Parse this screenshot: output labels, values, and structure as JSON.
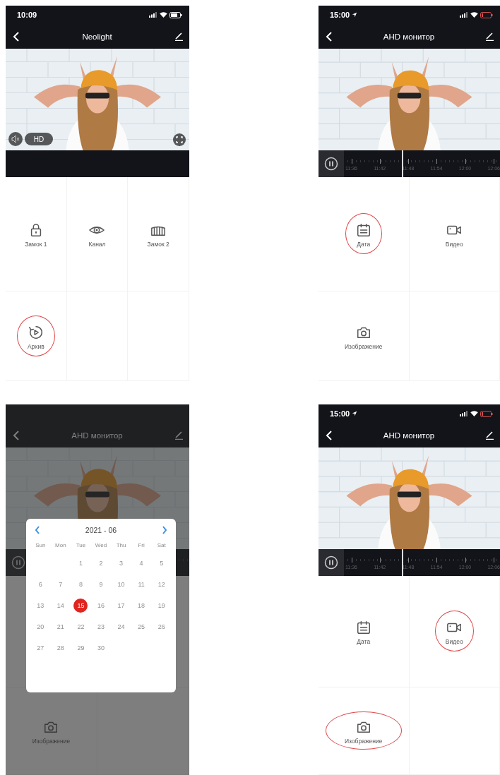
{
  "screens": [
    {
      "kind": "live",
      "status_bar": {
        "time": "10:09",
        "battery_low": false
      },
      "title": "Neolight",
      "hd_label": "HD",
      "action_rows": [
        [
          {
            "kind": "lock",
            "label": "Замок 1",
            "highlighted": false
          },
          {
            "kind": "eye",
            "label": "Канал",
            "highlighted": false
          },
          {
            "kind": "gate",
            "label": "Замок 2",
            "highlighted": false
          }
        ],
        [
          {
            "kind": "archive",
            "label": "Архив",
            "highlighted": true
          }
        ]
      ]
    },
    {
      "kind": "playback",
      "status_bar": {
        "time": "15:00",
        "location": true,
        "battery_low": true
      },
      "title": "AHD монитор",
      "timeline": {
        "playing": true,
        "labels": [
          "11:36",
          "11:42",
          "11:48",
          "11:54",
          "12:00",
          "12:06"
        ]
      },
      "action_rows": [
        [
          {
            "kind": "date",
            "label": "Дата",
            "highlighted": true
          },
          {
            "kind": "video",
            "label": "Видео",
            "highlighted": false
          }
        ],
        [
          {
            "label": "Изображение",
            "highlighted": false
          }
        ]
      ]
    },
    {
      "kind": "playback",
      "dimmed": true,
      "title": "AHD монитор",
      "timeline": {
        "playing": true
      },
      "dialog": {
        "title": "2021 - 06",
        "weekdays": [
          "Sun",
          "Mon",
          "Tue",
          "Wed",
          "Thu",
          "Fri",
          "Sat"
        ],
        "weeks": [
          [
            {
              "label": "1",
              "selected": false
            },
            {
              "label": "2",
              "selected": false
            },
            {
              "label": "3",
              "selected": false
            },
            {
              "label": "4",
              "selected": false
            },
            {
              "label": "5",
              "selected": false
            }
          ],
          [
            {
              "label": "6",
              "selected": false
            },
            {
              "label": "7",
              "selected": false
            },
            {
              "label": "8",
              "selected": false
            },
            {
              "label": "9",
              "selected": false
            },
            {
              "label": "10",
              "selected": false
            },
            {
              "label": "11",
              "selected": false
            },
            {
              "label": "12",
              "selected": false
            }
          ],
          [
            {
              "label": "13",
              "selected": false
            },
            {
              "label": "14",
              "selected": false
            },
            {
              "label": "15",
              "selected": true
            },
            {
              "label": "16",
              "selected": false
            },
            {
              "label": "17",
              "selected": false
            },
            {
              "label": "18",
              "selected": false
            },
            {
              "label": "19",
              "selected": false
            }
          ],
          [
            {
              "label": "20",
              "selected": false
            },
            {
              "label": "21",
              "selected": false
            },
            {
              "label": "22",
              "selected": false
            },
            {
              "label": "23",
              "selected": false
            },
            {
              "label": "24",
              "selected": false
            },
            {
              "label": "25",
              "selected": false
            },
            {
              "label": "26",
              "selected": false
            }
          ],
          [
            {
              "label": "27",
              "selected": false
            },
            {
              "label": "28",
              "selected": false
            },
            {
              "label": "29",
              "selected": false
            },
            {
              "label": "30",
              "selected": false
            }
          ]
        ]
      },
      "action_rows": [
        [
          {
            "label": "Изображение",
            "highlighted": false
          }
        ]
      ]
    },
    {
      "kind": "playback",
      "status_bar": {
        "time": "15:00",
        "location": true,
        "battery_low": true
      },
      "title": "AHD монитор",
      "timeline": {
        "playing": true,
        "labels": [
          "11:36",
          "11:42",
          "11:48",
          "11:54",
          "12:00",
          "12:06"
        ]
      },
      "action_rows": [
        [
          {
            "kind": "date",
            "label": "Дата",
            "highlighted": false
          },
          {
            "kind": "video",
            "label": "Видео",
            "highlighted": true
          }
        ],
        [
          {
            "label": "Изображение",
            "highlighted": true
          }
        ]
      ]
    }
  ]
}
